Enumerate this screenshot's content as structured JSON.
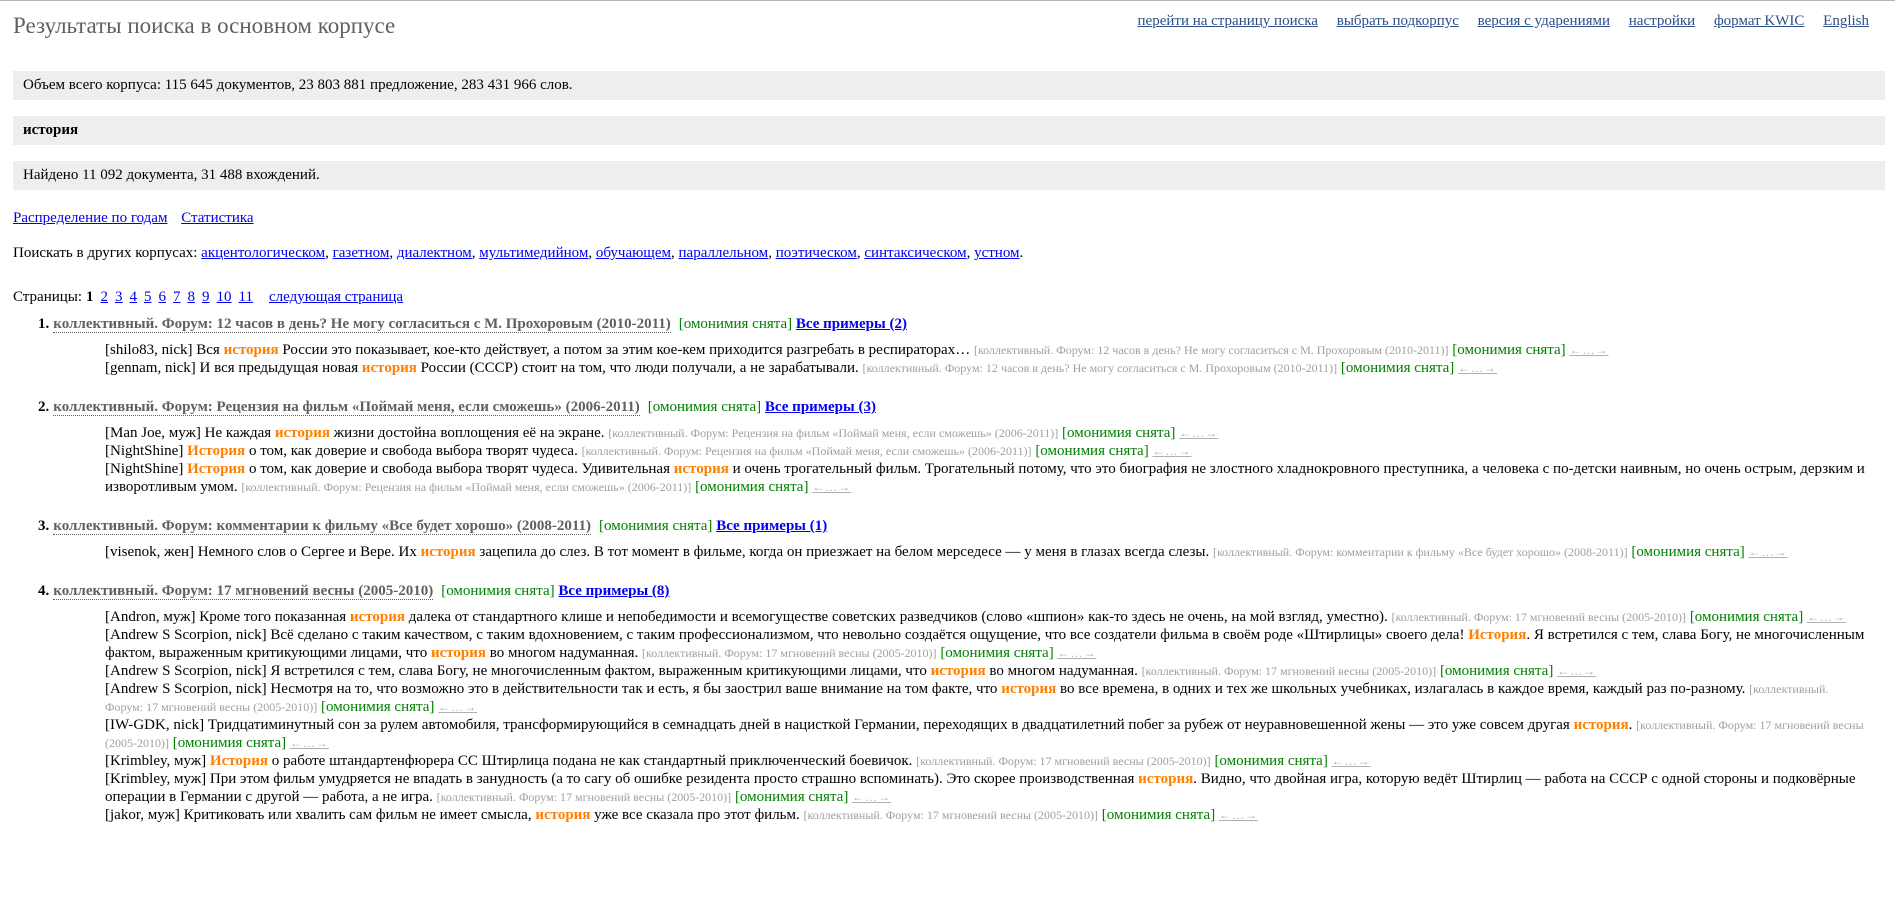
{
  "title": "Результаты поиска в основном корпусе",
  "nav": [
    "перейти на страницу поиска",
    "выбрать подкорпус",
    "версия с ударениями",
    "настройки",
    "формат KWIC",
    "English"
  ],
  "corpus_size": "Объем всего корпуса: 115 645 документов, 23 803 881 предложение, 283 431 966 слов.",
  "query": "история",
  "found": "Найдено 11 092 документа, 31 488 вхождений.",
  "stats_links": [
    "Распределение по годам",
    "Статистика"
  ],
  "other_corpora": {
    "label": "Поискать в других корпусах:",
    "items": [
      "акцентологическом",
      "газетном",
      "диалектном",
      "мультимедийном",
      "обучающем",
      "параллельном",
      "поэтическом",
      "синтаксическом",
      "устном"
    ]
  },
  "pagination": {
    "label": "Страницы:",
    "current": "1",
    "pages": [
      "2",
      "3",
      "4",
      "5",
      "6",
      "7",
      "8",
      "9",
      "10",
      "11"
    ],
    "next": "следующая страница"
  },
  "homonymy_label": "[омонимия снята]",
  "context_arrows": "←…→",
  "documents": [
    {
      "num": "1.",
      "title": "коллективный. Форум: 12 часов в день? Не могу согласиться с М. Прохоровым (2010-2011)",
      "all_examples": "Все примеры (2)",
      "snippets": [
        {
          "pre": "[shilo83, nick] Вся ",
          "hit": "история",
          "post": " России это показывает, кое-кто действует, а потом за этим кое-кем приходится разгребать в респираторах… ",
          "hit2": "",
          "post2": "",
          "source": "[коллективный. Форум: 12 часов в день? Не могу согласиться с М. Прохоровым (2010-2011)]"
        },
        {
          "pre": "[gennam, nick] И вся предыдущая новая ",
          "hit": "история",
          "post": " России (СССР) стоит на том, что люди получали, а не зарабатывали. ",
          "hit2": "",
          "post2": "",
          "source": "[коллективный. Форум: 12 часов в день? Не могу согласиться с М. Прохоровым (2010-2011)]"
        }
      ]
    },
    {
      "num": "2.",
      "title": "коллективный. Форум: Рецензия на фильм «Поймай меня, если сможешь» (2006-2011)",
      "all_examples": "Все примеры (3)",
      "snippets": [
        {
          "pre": "[Man Joe, муж] Не каждая ",
          "hit": "история",
          "post": " жизни достойна воплощения её на экране. ",
          "hit2": "",
          "post2": "",
          "source": "[коллективный. Форум: Рецензия на фильм «Поймай меня, если сможешь» (2006-2011)]"
        },
        {
          "pre": "[NightShine] ",
          "hit": "История",
          "post": " о том, как доверие и свобода выбора творят чудеса. ",
          "hit2": "",
          "post2": "",
          "source": "[коллективный. Форум: Рецензия на фильм «Поймай меня, если сможешь» (2006-2011)]"
        },
        {
          "pre": "[NightShine] ",
          "hit": "История",
          "post": " о том, как доверие и свобода выбора творят чудеса. Удивительная ",
          "hit2": "история",
          "post2": " и очень трогательный фильм. Трогательный потому, что это биография не злостного хладнокровного преступника, а человека с по-детски наивным, но очень острым, дерзким и изворотливым умом. ",
          "source": "[коллективный. Форум: Рецензия на фильм «Поймай меня, если сможешь» (2006-2011)]"
        }
      ]
    },
    {
      "num": "3.",
      "title": "коллективный. Форум: комментарии к фильму «Все будет хорошо» (2008-2011)",
      "all_examples": "Все примеры (1)",
      "snippets": [
        {
          "pre": "[visenok, жен] Немного слов о Сергее и Вере. Их ",
          "hit": "история",
          "post": " зацепила до слез. В тот момент в фильме, когда он приезжает на белом мерседесе — у меня в глазах всегда слезы. ",
          "hit2": "",
          "post2": "",
          "source": "[коллективный. Форум: комментарии к фильму «Все будет хорошо» (2008-2011)]"
        }
      ]
    },
    {
      "num": "4.",
      "title": "коллективный. Форум: 17 мгновений весны (2005-2010)",
      "all_examples": "Все примеры (8)",
      "snippets": [
        {
          "pre": "[Andron, муж] Кроме того показанная ",
          "hit": "история",
          "post": " далека от стандартного клише и непобедимости и всемогуществе советских разведчиков (слово «шпион» как-то здесь не очень, на мой взгляд, уместно). ",
          "hit2": "",
          "post2": "",
          "source": "[коллективный. Форум: 17 мгновений весны (2005-2010)]"
        },
        {
          "pre": "[Andrew S Scorpion, nick] Всё сделано с таким качеством, с таким вдохновением, с таким профессионализмом, что невольно создаётся ощущение, что все создатели фильма в своём роде «Штирлицы» своего дела! ",
          "hit": "История",
          "post": ". Я встретился с тем, слава Богу, не многочисленным фактом, выраженным критикующими лицами, что ",
          "hit2": "история",
          "post2": " во многом надуманная. ",
          "source": "[коллективный. Форум: 17 мгновений весны (2005-2010)]"
        },
        {
          "pre": "[Andrew S Scorpion, nick] Я встретился с тем, слава Богу, не многочисленным фактом, выраженным критикующими лицами, что ",
          "hit": "история",
          "post": " во многом надуманная. ",
          "hit2": "",
          "post2": "",
          "source": "[коллективный. Форум: 17 мгновений весны (2005-2010)]"
        },
        {
          "pre": "[Andrew S Scorpion, nick] Несмотря на то, что возможно это в действительности так и есть, я бы заострил ваше внимание на том факте, что ",
          "hit": "история",
          "post": " во все времена, в одних и тех же школьных учебниках, излагалась в каждое время, каждый раз по-разному. ",
          "hit2": "",
          "post2": "",
          "source": "[коллективный. Форум: 17 мгновений весны (2005-2010)]"
        },
        {
          "pre": "[IW-GDK, nick] Тридцатиминутный сон за рулем автомобиля, трансформирующийся в семнадцать дней в нацисткой Германии, переходящих в двадцатилетний побег за рубеж от неуравновешенной жены — это уже совсем другая ",
          "hit": "история",
          "post": ". ",
          "hit2": "",
          "post2": "",
          "source": "[коллективный. Форум: 17 мгновений весны (2005-2010)]"
        },
        {
          "pre": "[Krimbley, муж] ",
          "hit": "История",
          "post": " о работе штандартенфюрера СС Штирлица подана не как стандартный приключенческий боевичок. ",
          "hit2": "",
          "post2": "",
          "source": "[коллективный. Форум: 17 мгновений весны (2005-2010)]"
        },
        {
          "pre": "[Krimbley, муж] При этом фильм умудряется не впадать в занудность (а то сагу об ошибке резидента просто страшно вспоминать). Это скорее производственная ",
          "hit": "история",
          "post": ". Видно, что двойная игра, которую ведёт Штирлиц — работа на СССР с одной стороны и подковёрные операции в Германии с другой — работа, а не игра. ",
          "hit2": "",
          "post2": "",
          "source": "[коллективный. Форум: 17 мгновений весны (2005-2010)]"
        },
        {
          "pre": "[jakor, муж] Критиковать или хвалить сам фильм не имеет смысла, ",
          "hit": "история",
          "post": " уже все сказала про этот фильм. ",
          "hit2": "",
          "post2": "",
          "source": "[коллективный. Форум: 17 мгновений весны (2005-2010)]"
        }
      ]
    }
  ]
}
